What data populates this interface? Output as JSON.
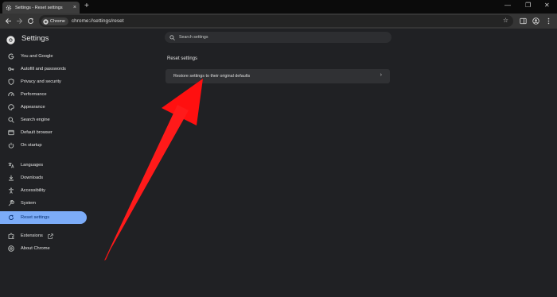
{
  "tab": {
    "title": "Settings - Reset settings",
    "close_label": "×",
    "new_tab_label": "+"
  },
  "window_controls": {
    "minimize": "—",
    "maximize": "❐",
    "close": "✕"
  },
  "omnibox": {
    "chip_label": "Chrome",
    "url": "chrome://settings/reset"
  },
  "header": {
    "title": "Settings",
    "search_placeholder": "Search settings"
  },
  "sidebar": {
    "items": [
      {
        "label": "You and Google",
        "icon": "google-icon"
      },
      {
        "label": "Autofill and passwords",
        "icon": "key-icon"
      },
      {
        "label": "Privacy and security",
        "icon": "shield-icon"
      },
      {
        "label": "Performance",
        "icon": "speedometer-icon"
      },
      {
        "label": "Appearance",
        "icon": "palette-icon"
      },
      {
        "label": "Search engine",
        "icon": "search-icon"
      },
      {
        "label": "Default browser",
        "icon": "browser-icon"
      },
      {
        "label": "On startup",
        "icon": "power-icon"
      },
      {
        "label": "Languages",
        "icon": "translate-icon"
      },
      {
        "label": "Downloads",
        "icon": "download-icon"
      },
      {
        "label": "Accessibility",
        "icon": "accessibility-icon"
      },
      {
        "label": "System",
        "icon": "wrench-icon"
      },
      {
        "label": "Reset settings",
        "icon": "reset-icon",
        "active": true
      },
      {
        "label": "Extensions",
        "icon": "puzzle-icon"
      },
      {
        "label": "About Chrome",
        "icon": "chrome-icon"
      }
    ]
  },
  "main": {
    "section_title": "Reset settings",
    "restore_label": "Restore settings to their original defaults"
  },
  "colors": {
    "accent": "#7cacf8",
    "annotation_arrow": "#ff0000"
  }
}
